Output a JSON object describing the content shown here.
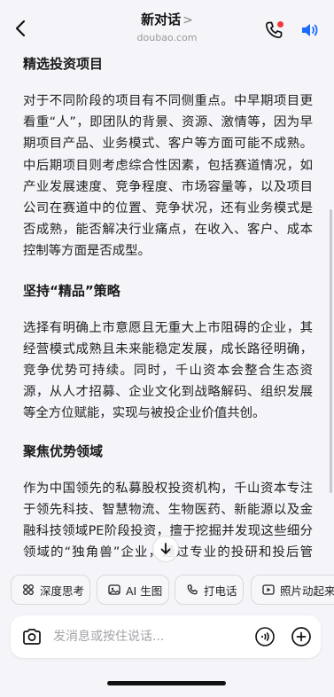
{
  "header": {
    "title": "新对话",
    "title_chevron": ">",
    "subtitle": "doubao.com",
    "icons": {
      "back": "chevron-left-icon",
      "call": "phone-icon",
      "speaker": "speaker-icon"
    },
    "accent_color": "#1a6cff",
    "notification_dot_color": "#f03a3a"
  },
  "content": {
    "sections": [
      {
        "heading": "精选投资项目",
        "body": "对于不同阶段的项目有不同侧重点。中早期项目更看重“人”，即团队的背景、资源、激情等，因为早期项目产品、业务模式、客户等方面可能不成熟。中后期项目则考虑综合性因素，包括赛道情况，如产业发展速度、竞争程度、市场容量等，以及项目公司在赛道中的位置、竞争状况，还有业务模式是否成熟，能否解决行业痛点，在收入、客户、成本控制等方面是否成型。"
      },
      {
        "heading": "坚持“精品”策略",
        "body": "选择有明确上市意愿且无重大上市阻碍的企业，其经营模式成熟且未来能稳定发展，成长路径明确，竞争优势可持续。同时，千山资本会整合生态资源，从人才招募、企业文化到战略解码、组织发展等全方位赋能，实现与被投企业价值共创。"
      },
      {
        "heading": "聚焦优势领域",
        "body": "作为中国领先的私募股权投资机构，千山资本专注于领先科技、智慧物流、生物医药、新能源以及金融科技领域PE阶段投资，擅于挖掘并发现这些细分领域的“独角兽”企业，通过专业的投研和投后管理，助力企业成长，为投资者获取长"
      }
    ]
  },
  "quick_actions": [
    {
      "label": "深度思考",
      "icon": "deep-think-icon"
    },
    {
      "label": "AI 生图",
      "icon": "image-icon"
    },
    {
      "label": "打电话",
      "icon": "phone-icon"
    },
    {
      "label": "照片动起来",
      "icon": "play-video-icon"
    }
  ],
  "input_bar": {
    "placeholder": "发消息或按住说话...",
    "value": "",
    "icons": {
      "camera": "camera-icon",
      "voice": "voice-wave-icon",
      "plus": "plus-icon"
    }
  },
  "scroll_down_icon": "arrow-down-icon"
}
